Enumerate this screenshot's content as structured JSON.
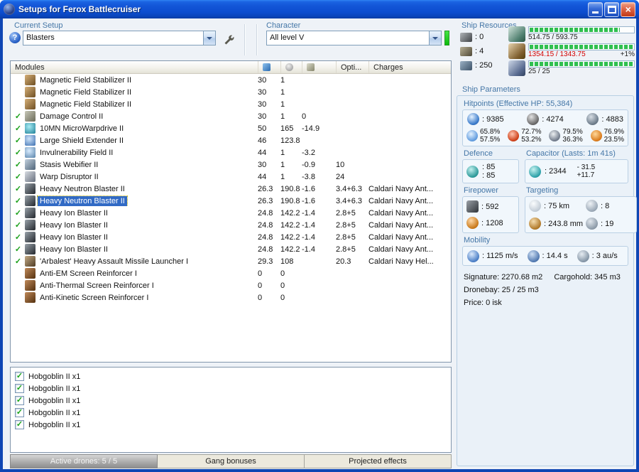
{
  "colors": {
    "label_blue": "#4577a7",
    "selection_blue": "#316ac5",
    "over_red": "#d40000",
    "bar_green": "#2fbf4f",
    "check_green": "#18a018"
  },
  "window": {
    "title": "Setups for Ferox Battlecruiser"
  },
  "setup": {
    "label": "Current Setup",
    "value": "Blasters"
  },
  "character": {
    "label": "Character",
    "value": "All level V"
  },
  "resources": {
    "label": "Ship Resources",
    "counts": [
      {
        "icon": "turret",
        "value": ": 0"
      },
      {
        "icon": "launcher",
        "value": ": 4"
      },
      {
        "icon": "drone",
        "value": ": 250"
      }
    ],
    "bars": [
      {
        "icon": "cpu",
        "fill": 87,
        "text": "514.75 / 593.75",
        "over": false,
        "extra": ""
      },
      {
        "icon": "powergrid",
        "fill": 100,
        "text": "1354.15 / 1343.75",
        "over": true,
        "extra": "+1%"
      },
      {
        "icon": "dronebay",
        "fill": 100,
        "text": "25 / 25",
        "over": false,
        "extra": ""
      }
    ]
  },
  "modules": {
    "col_modules": "Modules",
    "col_opti": "Opti...",
    "col_charges": "Charges",
    "rows": [
      {
        "check": false,
        "selected": false,
        "icon": "magstab",
        "name": "Magnetic Field Stabilizer II",
        "cpu": "30",
        "pg": "1",
        "cap": "",
        "opti": "",
        "charge": ""
      },
      {
        "check": false,
        "selected": false,
        "icon": "magstab",
        "name": "Magnetic Field Stabilizer II",
        "cpu": "30",
        "pg": "1",
        "cap": "",
        "opti": "",
        "charge": ""
      },
      {
        "check": false,
        "selected": false,
        "icon": "magstab",
        "name": "Magnetic Field Stabilizer II",
        "cpu": "30",
        "pg": "1",
        "cap": "",
        "opti": "",
        "charge": ""
      },
      {
        "check": true,
        "selected": false,
        "icon": "dc",
        "name": "Damage Control II",
        "cpu": "30",
        "pg": "1",
        "cap": "0",
        "opti": "",
        "charge": ""
      },
      {
        "check": true,
        "selected": false,
        "icon": "mwd",
        "name": "10MN MicroWarpdrive II",
        "cpu": "50",
        "pg": "165",
        "cap": "-14.9",
        "opti": "",
        "charge": ""
      },
      {
        "check": true,
        "selected": false,
        "icon": "shieldext",
        "name": "Large Shield Extender II",
        "cpu": "46",
        "pg": "123.8",
        "cap": "",
        "opti": "",
        "charge": ""
      },
      {
        "check": true,
        "selected": false,
        "icon": "invuln",
        "name": "Invulnerability Field II",
        "cpu": "44",
        "pg": "1",
        "cap": "-3.2",
        "opti": "",
        "charge": ""
      },
      {
        "check": true,
        "selected": false,
        "icon": "web",
        "name": "Stasis Webifier II",
        "cpu": "30",
        "pg": "1",
        "cap": "-0.9",
        "opti": "10",
        "charge": ""
      },
      {
        "check": true,
        "selected": false,
        "icon": "disruptor",
        "name": "Warp Disruptor II",
        "cpu": "44",
        "pg": "1",
        "cap": "-3.8",
        "opti": "24",
        "charge": ""
      },
      {
        "check": true,
        "selected": false,
        "icon": "blaster",
        "name": "Heavy Neutron Blaster II",
        "cpu": "26.3",
        "pg": "190.8",
        "cap": "-1.6",
        "opti": "3.4+6.3",
        "charge": "Caldari Navy Ant..."
      },
      {
        "check": true,
        "selected": true,
        "icon": "blaster",
        "name": "Heavy Neutron Blaster II",
        "cpu": "26.3",
        "pg": "190.8",
        "cap": "-1.6",
        "opti": "3.4+6.3",
        "charge": "Caldari Navy Ant..."
      },
      {
        "check": true,
        "selected": false,
        "icon": "blaster",
        "name": "Heavy Ion Blaster II",
        "cpu": "24.8",
        "pg": "142.2",
        "cap": "-1.4",
        "opti": "2.8+5",
        "charge": "Caldari Navy Ant..."
      },
      {
        "check": true,
        "selected": false,
        "icon": "blaster",
        "name": "Heavy Ion Blaster II",
        "cpu": "24.8",
        "pg": "142.2",
        "cap": "-1.4",
        "opti": "2.8+5",
        "charge": "Caldari Navy Ant..."
      },
      {
        "check": true,
        "selected": false,
        "icon": "blaster",
        "name": "Heavy Ion Blaster II",
        "cpu": "24.8",
        "pg": "142.2",
        "cap": "-1.4",
        "opti": "2.8+5",
        "charge": "Caldari Navy Ant..."
      },
      {
        "check": true,
        "selected": false,
        "icon": "blaster",
        "name": "Heavy Ion Blaster II",
        "cpu": "24.8",
        "pg": "142.2",
        "cap": "-1.4",
        "opti": "2.8+5",
        "charge": "Caldari Navy Ant..."
      },
      {
        "check": true,
        "selected": false,
        "icon": "launcher",
        "name": "'Arbalest' Heavy Assault Missile Launcher I",
        "cpu": "29.3",
        "pg": "108",
        "cap": "",
        "opti": "20.3",
        "charge": "Caldari Navy Hel..."
      },
      {
        "check": false,
        "selected": false,
        "icon": "rig",
        "name": "Anti-EM Screen Reinforcer I",
        "cpu": "0",
        "pg": "0",
        "cap": "",
        "opti": "",
        "charge": ""
      },
      {
        "check": false,
        "selected": false,
        "icon": "rig",
        "name": "Anti-Thermal Screen Reinforcer I",
        "cpu": "0",
        "pg": "0",
        "cap": "",
        "opti": "",
        "charge": ""
      },
      {
        "check": false,
        "selected": false,
        "icon": "rig",
        "name": "Anti-Kinetic Screen Reinforcer I",
        "cpu": "0",
        "pg": "0",
        "cap": "",
        "opti": "",
        "charge": ""
      }
    ]
  },
  "drones": {
    "items": [
      {
        "label": "Hobgoblin II x1",
        "checked": true
      },
      {
        "label": "Hobgoblin II x1",
        "checked": true
      },
      {
        "label": "Hobgoblin II x1",
        "checked": true
      },
      {
        "label": "Hobgoblin II x1",
        "checked": true
      },
      {
        "label": "Hobgoblin II x1",
        "checked": true
      }
    ]
  },
  "tabs": {
    "active_drones": "Active drones: 5 / 5",
    "gang_bonuses": "Gang bonuses",
    "projected_effects": "Projected effects"
  },
  "params": {
    "label": "Ship Parameters",
    "hitpoints": {
      "label": "Hitpoints (Effective HP: 55,384)",
      "shield": ": 9385",
      "armor": ": 4274",
      "hull": ": 4883",
      "resists": [
        {
          "type": "em",
          "shield": "65.8%",
          "armor": "57.5%"
        },
        {
          "type": "thermal",
          "shield": "72.7%",
          "armor": "53.2%"
        },
        {
          "type": "kinetic",
          "shield": "79.5%",
          "armor": "36.3%"
        },
        {
          "type": "explosive",
          "shield": "76.9%",
          "armor": "23.5%"
        }
      ]
    },
    "defence": {
      "label": "Defence",
      "value1": ": 85",
      "value2": ": 85"
    },
    "capacitor": {
      "label": "Capacitor (Lasts: 1m 41s)",
      "amount": ": 2344",
      "drain": "- 31.5",
      "recharge": "+11.7"
    },
    "firepower": {
      "label": "Firepower",
      "volley": ": 592",
      "dps": ": 1208"
    },
    "targeting": {
      "label": "Targeting",
      "range": ": 75 km",
      "max_targets": ": 8",
      "scan_res": ": 243.8 mm",
      "sensor_strength": ": 19"
    },
    "mobility": {
      "label": "Mobility",
      "speed": ": 1125 m/s",
      "align": ": 14.4 s",
      "warp": ": 3 au/s"
    },
    "signature": "Signature: 2270.68 m2",
    "cargohold": "Cargohold: 345 m3",
    "dronebay": "Dronebay: 25 / 25 m3",
    "price": "Price: 0 isk"
  }
}
